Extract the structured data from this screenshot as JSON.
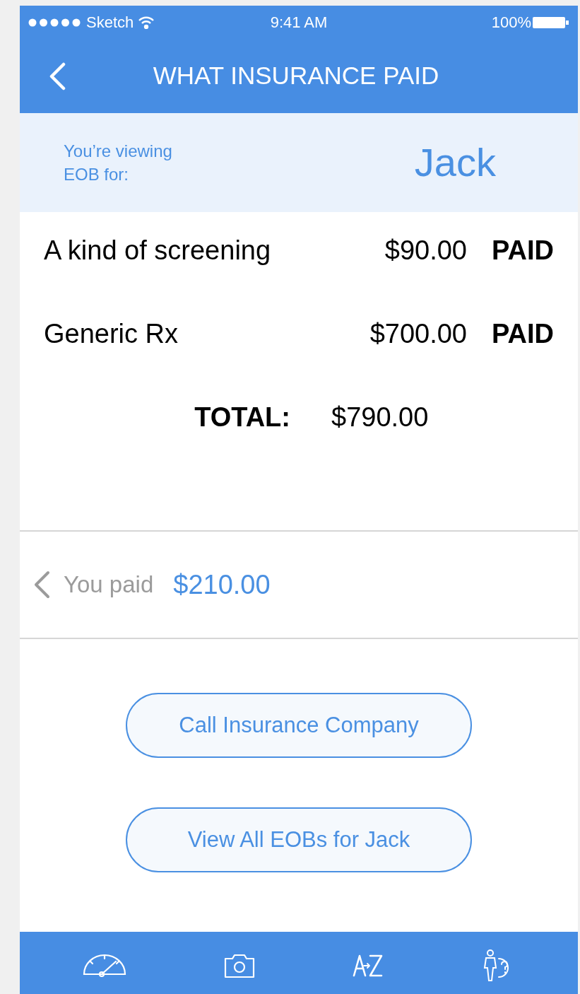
{
  "status_bar": {
    "carrier": "Sketch",
    "time": "9:41 AM",
    "battery": "100%"
  },
  "nav": {
    "title": "WHAT INSURANCE PAID"
  },
  "viewer": {
    "label": "You’re viewing EOB for:",
    "name": "Jack"
  },
  "items": [
    {
      "description": "A kind of screening",
      "amount": "$90.00",
      "status": "PAID"
    },
    {
      "description": "Generic Rx",
      "amount": "$700.00",
      "status": "PAID"
    }
  ],
  "total": {
    "label": "TOTAL:",
    "amount": "$790.00"
  },
  "you_paid": {
    "label": "You paid",
    "amount": "$210.00"
  },
  "buttons": [
    "Call Insurance Company",
    "View All EOBs for Jack"
  ]
}
